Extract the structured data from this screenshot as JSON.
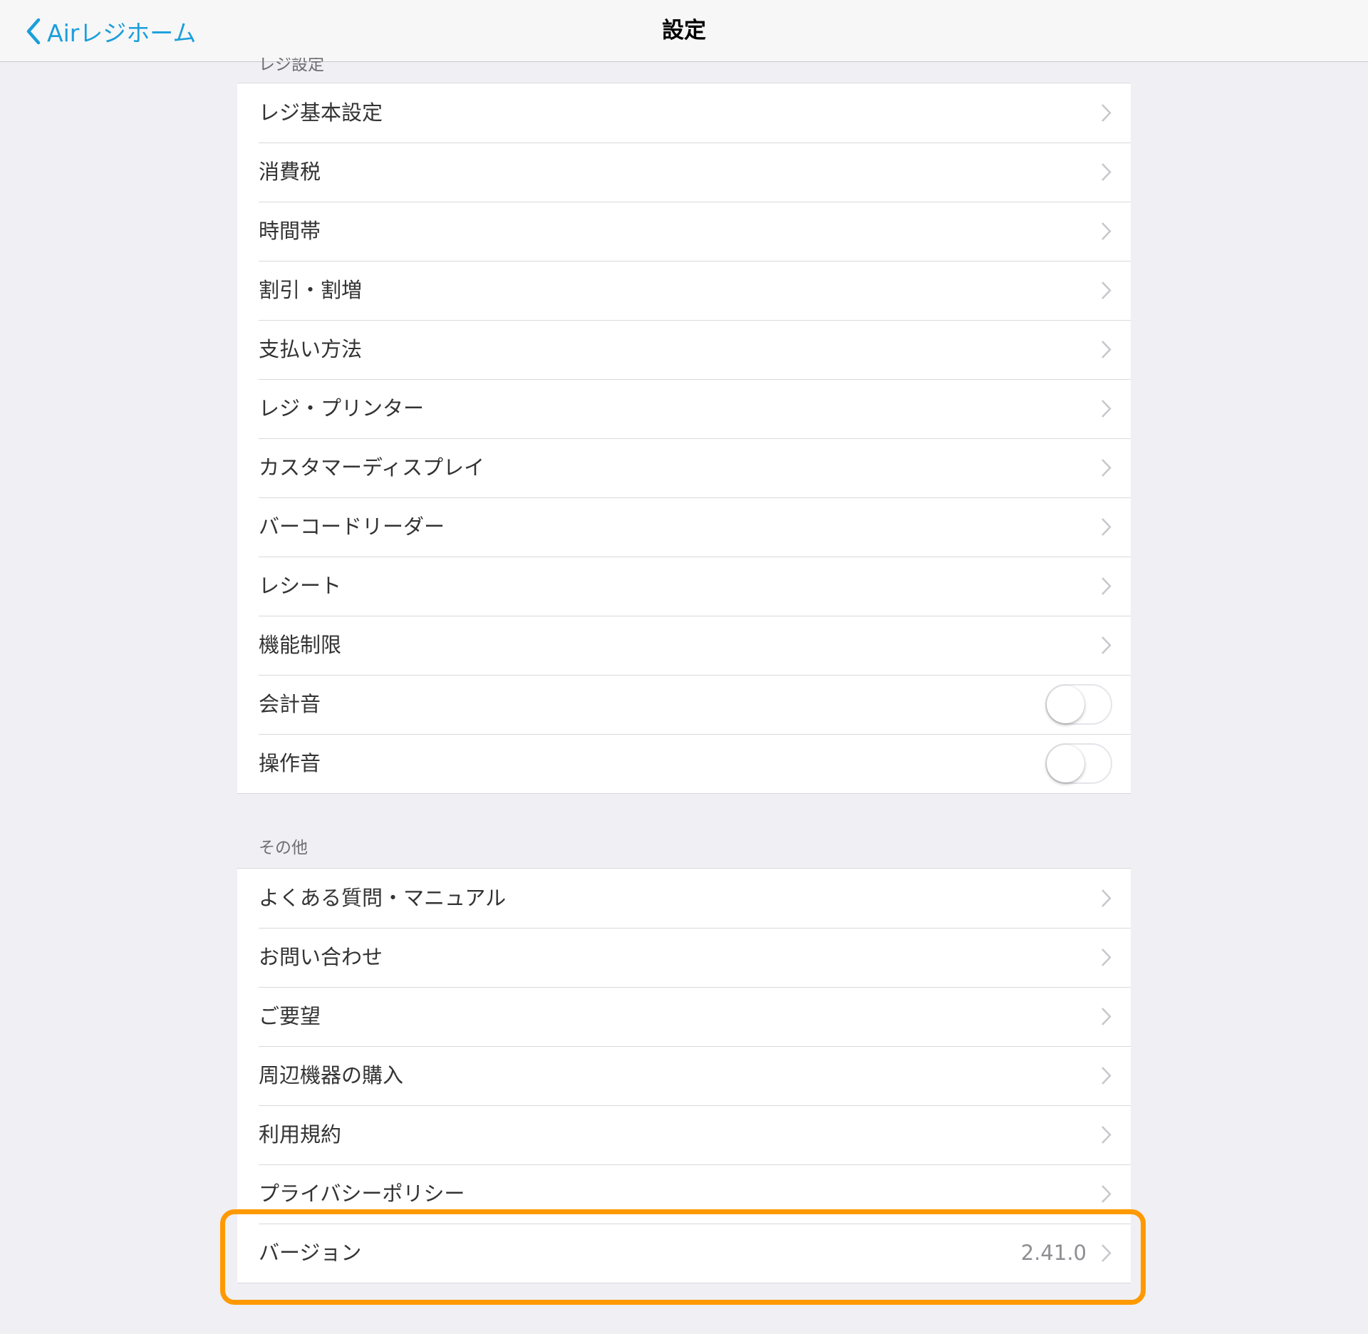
{
  "navbar": {
    "back_label": "Airレジホーム",
    "title": "設定"
  },
  "sections": [
    {
      "header": "レジ設定",
      "rows": [
        {
          "label": "レジ基本設定",
          "type": "link"
        },
        {
          "label": "消費税",
          "type": "link"
        },
        {
          "label": "時間帯",
          "type": "link"
        },
        {
          "label": "割引・割増",
          "type": "link"
        },
        {
          "label": "支払い方法",
          "type": "link"
        },
        {
          "label": "レジ・プリンター",
          "type": "link"
        },
        {
          "label": "カスタマーディスプレイ",
          "type": "link"
        },
        {
          "label": "バーコードリーダー",
          "type": "link"
        },
        {
          "label": "レシート",
          "type": "link"
        },
        {
          "label": "機能制限",
          "type": "link"
        },
        {
          "label": "会計音",
          "type": "toggle",
          "on": false
        },
        {
          "label": "操作音",
          "type": "toggle",
          "on": false
        }
      ]
    },
    {
      "header": "その他",
      "rows": [
        {
          "label": "よくある質問・マニュアル",
          "type": "link"
        },
        {
          "label": "お問い合わせ",
          "type": "link"
        },
        {
          "label": "ご要望",
          "type": "link"
        },
        {
          "label": "周辺機器の購入",
          "type": "link"
        },
        {
          "label": "利用規約",
          "type": "link"
        },
        {
          "label": "プライバシーポリシー",
          "type": "link"
        },
        {
          "label": "バージョン",
          "type": "link",
          "value": "2.41.0"
        }
      ]
    }
  ],
  "colors": {
    "accent": "#1b9fdb",
    "background": "#efeff4",
    "highlight": "#ff9900"
  },
  "icons": {
    "back": "chevron-left-icon",
    "row_disclosure": "chevron-right-icon"
  }
}
